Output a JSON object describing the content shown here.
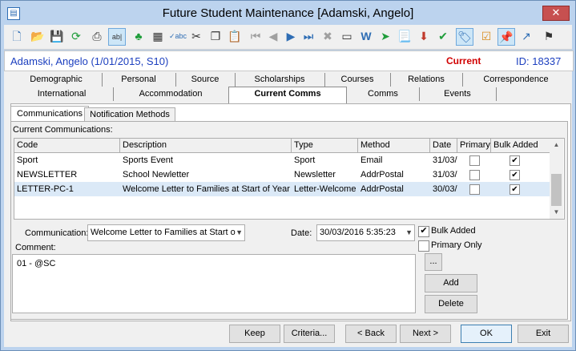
{
  "window": {
    "title": "Future Student Maintenance  [Adamski, Angelo]",
    "close_glyph": "✕"
  },
  "toolbar": {
    "icons": [
      "new-document-icon",
      "open-folder-icon",
      "save-icon",
      "refresh-icon",
      "print-icon",
      "field-edit-icon",
      "tree-icon",
      "calculator-icon",
      "spellcheck-icon",
      "cut-icon",
      "copy-icon",
      "paste-icon",
      "first-record-icon",
      "previous-record-icon",
      "next-record-icon",
      "last-record-icon",
      "delete-icon",
      "comment-icon",
      "word-icon",
      "merge-icon",
      "clipboard-icon",
      "export-icon",
      "approve-icon",
      "tag-icon",
      "checklist-icon",
      "pin-icon",
      "jump-icon",
      "flag-icon"
    ]
  },
  "student": {
    "name": "Adamski, Angelo (1/01/2015, S10)",
    "status": "Current",
    "id": "ID: 18337"
  },
  "tabs": {
    "row1": [
      "Demographic",
      "Personal",
      "Source",
      "Scholarships",
      "Courses",
      "Relations",
      "Correspondence"
    ],
    "row2": [
      "International",
      "Accommodation",
      "Current Comms",
      "Comms",
      "Events"
    ],
    "selected": "Current Comms"
  },
  "subtabs": {
    "items": [
      "Communications",
      "Notification Methods"
    ],
    "selected": "Communications"
  },
  "grid": {
    "caption": "Current Communications:",
    "columns": [
      "Code",
      "Description",
      "Type",
      "Method",
      "Date",
      "Primary",
      "Bulk Added"
    ],
    "rows": [
      {
        "code": "Sport",
        "description": "Sports Event",
        "type": "Sport",
        "method": "Email",
        "date": "31/03/",
        "primary": false,
        "bulk_added": true
      },
      {
        "code": "NEWSLETTER",
        "description": "School Newletter",
        "type": "Newsletter",
        "method": "AddrPostal",
        "date": "31/03/",
        "primary": false,
        "bulk_added": true
      },
      {
        "code": "LETTER-PC-1",
        "description": "Welcome Letter to Families at Start of Year",
        "type": "Letter-Welcome",
        "method": "AddrPostal",
        "date": "30/03/",
        "primary": false,
        "bulk_added": true
      }
    ],
    "selected_row": 2
  },
  "form": {
    "communication_label": "Communication:",
    "communication_value": "Welcome Letter to Families at Start o",
    "date_label": "Date:",
    "date_value": "30/03/2016 5:35:23",
    "bulk_added_label": "Bulk Added",
    "bulk_added_checked": true,
    "primary_only_label": "Primary Only",
    "primary_only_checked": false,
    "comment_label": "Comment:",
    "comment_value": "01 - @SC",
    "ellipsis_label": "...",
    "add_label": "Add",
    "delete_label": "Delete"
  },
  "footer": {
    "keep": "Keep",
    "criteria": "Criteria...",
    "back": "< Back",
    "next": "Next >",
    "ok": "OK",
    "exit": "Exit"
  },
  "colors": {
    "title_bar": "#bcd3ee",
    "student_name": "#1c3fbf",
    "status_current": "#d10000",
    "selected_row": "#dbe9f7"
  }
}
